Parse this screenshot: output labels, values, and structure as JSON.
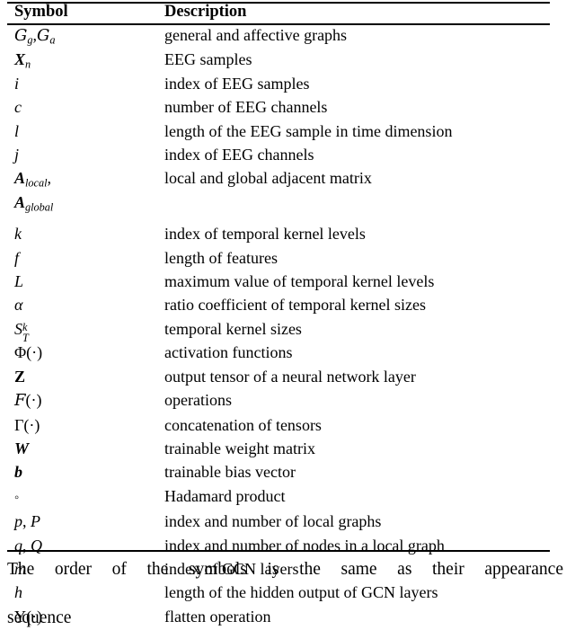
{
  "table": {
    "headers": {
      "symbol": "Symbol",
      "description": "Description"
    },
    "rows": [
      {
        "symbol_text": "Gg,Ga",
        "description": "general and affective graphs"
      },
      {
        "symbol_text": "Xn",
        "description": "EEG samples"
      },
      {
        "symbol_text": "i",
        "description": "index of EEG samples"
      },
      {
        "symbol_text": "c",
        "description": "number of EEG channels"
      },
      {
        "symbol_text": "l",
        "description": "length of the EEG sample in time dimension"
      },
      {
        "symbol_text": "j",
        "description": "index of EEG channels"
      },
      {
        "symbol_text": "Alocal,",
        "description": "local and global adjacent matrix"
      },
      {
        "symbol_text": "Aglobal",
        "description": ""
      },
      {
        "symbol_text": "k",
        "description": "index of temporal kernel levels"
      },
      {
        "symbol_text": "f",
        "description": "length of features"
      },
      {
        "symbol_text": "L",
        "description": "maximum value of temporal kernel levels"
      },
      {
        "symbol_text": "α",
        "description": "ratio coefficient of temporal kernel sizes"
      },
      {
        "symbol_text": "STk",
        "description": "temporal kernel sizes"
      },
      {
        "symbol_text": "Φ(·)",
        "description": "activation functions"
      },
      {
        "symbol_text": "Z",
        "description": "output tensor of a neural network layer"
      },
      {
        "symbol_text": "F(·)",
        "description": "operations"
      },
      {
        "symbol_text": "Γ(·)",
        "description": "concatenation of tensors"
      },
      {
        "symbol_text": "W",
        "description": "trainable weight matrix"
      },
      {
        "symbol_text": "b",
        "description": "trainable bias vector"
      },
      {
        "symbol_text": "∘",
        "description": "Hadamard product"
      },
      {
        "symbol_text": "p, P",
        "description": "index and number of local graphs"
      },
      {
        "symbol_text": "q, Q",
        "description": "index and number of nodes in a local graph"
      },
      {
        "symbol_text": "m",
        "description": "index of GCN layers"
      },
      {
        "symbol_text": "h",
        "description": "length of the hidden output of GCN layers"
      },
      {
        "symbol_text": "Υ(·)",
        "description": "flatten operation"
      }
    ]
  },
  "caption": {
    "line1": "The order of the symbols is the same as their appearance",
    "line2": "sequence",
    "full": "The order of the symbols is the same as their appearance sequence"
  },
  "colors": {
    "text": "#000000",
    "background": "#ffffff",
    "rule": "#000000"
  }
}
